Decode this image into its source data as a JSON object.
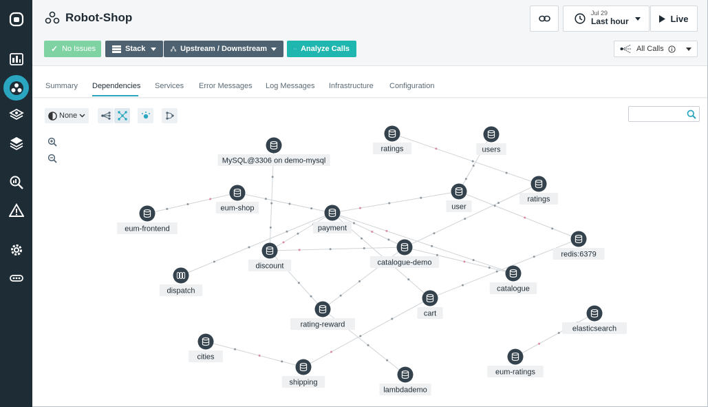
{
  "header": {
    "title": "Robot-Shop",
    "no_issues": "No Issues",
    "stack": "Stack",
    "upstream_downstream": "Upstream / Downstream",
    "analyze_calls": "Analyze Calls",
    "time_date": "Jul 29",
    "time_range": "Last hour",
    "live": "Live",
    "all_calls": "All Calls"
  },
  "tabs": [
    {
      "label": "Summary"
    },
    {
      "label": "Dependencies"
    },
    {
      "label": "Services"
    },
    {
      "label": "Error Messages"
    },
    {
      "label": "Log Messages"
    },
    {
      "label": "Infrastructure"
    },
    {
      "label": "Configuration"
    }
  ],
  "graph_toolbar": {
    "group_by": "None"
  },
  "search": {
    "placeholder": ""
  },
  "nodes": [
    {
      "id": "ratings_top",
      "label": "ratings",
      "icon": "database-icon"
    },
    {
      "id": "users",
      "label": "users",
      "icon": "database-icon"
    },
    {
      "id": "mysql",
      "label": "MySQL@3306 on demo-mysql",
      "icon": "database-icon"
    },
    {
      "id": "ratings",
      "label": "ratings",
      "icon": "database-icon"
    },
    {
      "id": "eum_shop",
      "label": "eum-shop",
      "icon": "database-icon"
    },
    {
      "id": "user",
      "label": "user",
      "icon": "database-icon"
    },
    {
      "id": "eum_frontend",
      "label": "eum-frontend",
      "icon": "database-icon"
    },
    {
      "id": "payment",
      "label": "payment",
      "icon": "database-icon"
    },
    {
      "id": "redis",
      "label": "redis:6379",
      "icon": "database-icon"
    },
    {
      "id": "catalogue_demo",
      "label": "catalogue-demo",
      "icon": "database-icon"
    },
    {
      "id": "discount",
      "label": "discount",
      "icon": "database-icon"
    },
    {
      "id": "dispatch",
      "label": "dispatch",
      "icon": "queue-icon"
    },
    {
      "id": "catalogue",
      "label": "catalogue",
      "icon": "database-icon"
    },
    {
      "id": "cart",
      "label": "cart",
      "icon": "database-icon"
    },
    {
      "id": "rating_reward",
      "label": "rating-reward",
      "icon": "database-icon"
    },
    {
      "id": "elasticsearch",
      "label": "elasticsearch",
      "icon": "database-icon"
    },
    {
      "id": "cities",
      "label": "cities",
      "icon": "database-icon"
    },
    {
      "id": "eum_ratings",
      "label": "eum-ratings",
      "icon": "database-icon"
    },
    {
      "id": "shipping",
      "label": "shipping",
      "icon": "database-icon"
    },
    {
      "id": "lambdademo",
      "label": "lambdademo",
      "icon": "database-icon"
    }
  ],
  "edges": [
    [
      "ratings_top",
      "ratings"
    ],
    [
      "users",
      "user"
    ],
    [
      "ratings",
      "catalogue_demo"
    ],
    [
      "user",
      "payment"
    ],
    [
      "user",
      "redis"
    ],
    [
      "eum_shop",
      "eum_frontend"
    ],
    [
      "eum_shop",
      "payment"
    ],
    [
      "mysql",
      "discount"
    ],
    [
      "payment",
      "discount"
    ],
    [
      "payment",
      "catalogue_demo"
    ],
    [
      "payment",
      "catalogue"
    ],
    [
      "payment",
      "dispatch"
    ],
    [
      "payment",
      "cart"
    ],
    [
      "catalogue_demo",
      "discount"
    ],
    [
      "catalogue_demo",
      "catalogue"
    ],
    [
      "catalogue_demo",
      "rating_reward"
    ],
    [
      "discount",
      "rating_reward"
    ],
    [
      "redis",
      "cart"
    ],
    [
      "cart",
      "shipping"
    ],
    [
      "cities",
      "shipping"
    ],
    [
      "eum_ratings",
      "elasticsearch"
    ],
    [
      "rating_reward",
      "lambdademo"
    ]
  ]
}
